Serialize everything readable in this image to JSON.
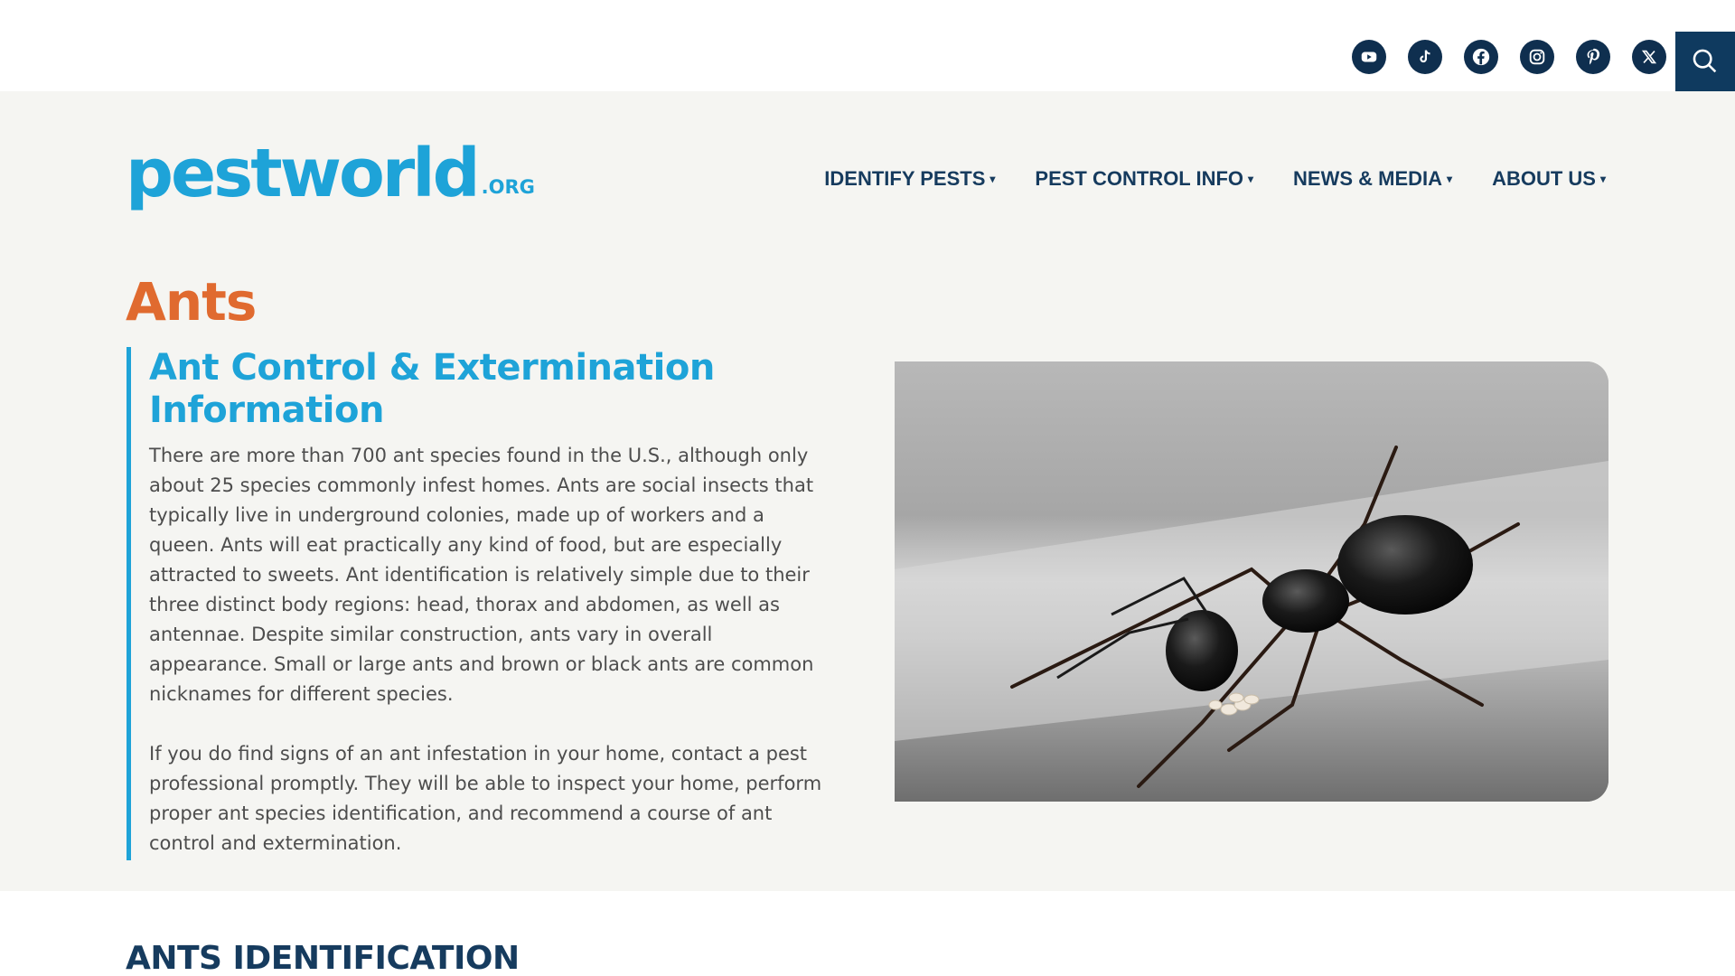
{
  "social": {
    "icons": [
      "youtube-icon",
      "tiktok-icon",
      "facebook-icon",
      "instagram-icon",
      "pinterest-icon",
      "x-icon"
    ]
  },
  "search": {
    "icon": "search-icon"
  },
  "logo": {
    "main": "pestworld",
    "suffix": ".ORG"
  },
  "nav": {
    "items": [
      {
        "label": "IDENTIFY PESTS"
      },
      {
        "label": "PEST CONTROL INFO"
      },
      {
        "label": "NEWS & MEDIA"
      },
      {
        "label": "ABOUT US"
      }
    ],
    "caret": "▾"
  },
  "hero": {
    "title": "Ants",
    "subtitle": "Ant Control & Extermination Information",
    "paragraphs": [
      "There are more than 700 ant species found in the U.S., although only about 25 species commonly infest homes. Ants are social insects that typically live in underground colonies, made up of workers and a queen. Ants will eat practically any kind of food, but are especially attracted to sweets. Ant identification is relatively simple due to their three distinct body regions: head, thorax and abdomen, as well as antennae. Despite similar construction, ants vary in overall appearance. Small or large ants and brown or black ants are common nicknames for different species.",
      "If you do find signs of an ant infestation in your home, contact a pest professional promptly. They will be able to inspect your home, perform proper ant species identification, and recommend a course of ant control and extermination."
    ]
  },
  "section": {
    "title": "ANTS IDENTIFICATION"
  },
  "colors": {
    "brand_blue": "#1ea3d8",
    "navy": "#163b5e",
    "title_orange": "#e06a2f",
    "hero_bg": "#f5f5f2"
  }
}
